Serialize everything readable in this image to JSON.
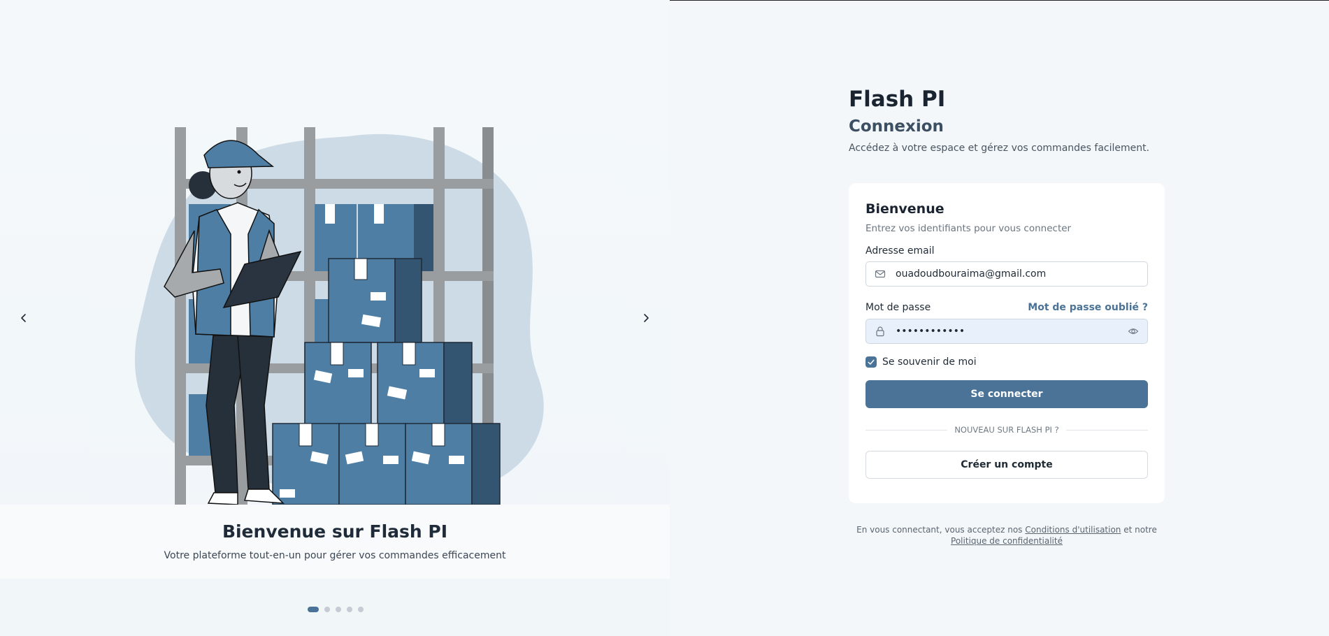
{
  "carousel": {
    "slide_title": "Bienvenue sur Flash PI",
    "slide_subtitle": "Votre plateforme tout-en-un pour gérer vos commandes efficacement",
    "prev_icon": "chevron-left-icon",
    "next_icon": "chevron-right-icon",
    "dot_count": 5,
    "active_dot": 1
  },
  "header": {
    "app_title": "Flash PI",
    "section_title": "Connexion",
    "subtitle": "Accédez à votre espace et gérez vos commandes facilement."
  },
  "card": {
    "title": "Bienvenue",
    "hint": "Entrez vos identifiants pour vous connecter",
    "email_label": "Adresse email",
    "email_value": "ouadoudbouraima@gmail.com",
    "email_icon": "mail-icon",
    "password_label": "Mot de passe",
    "forgot_link": "Mot de passe oublié ?",
    "password_value": "••••••••••••",
    "password_icon": "lock-icon",
    "toggle_visibility_icon": "eye-icon",
    "remember_label": "Se souvenir de moi",
    "remember_checked": true,
    "login_button": "Se connecter",
    "divider_text": "NOUVEAU SUR FLASH PI ?",
    "signup_button": "Créer un compte"
  },
  "legal": {
    "prefix": "En vous connectant, vous acceptez nos",
    "terms_link": "Conditions d'utilisation",
    "middle": "et notre",
    "privacy_link": "Politique de confidentialité"
  },
  "colors": {
    "accent": "#4a7397",
    "background": "#f3f7fa",
    "card": "#ffffff"
  }
}
